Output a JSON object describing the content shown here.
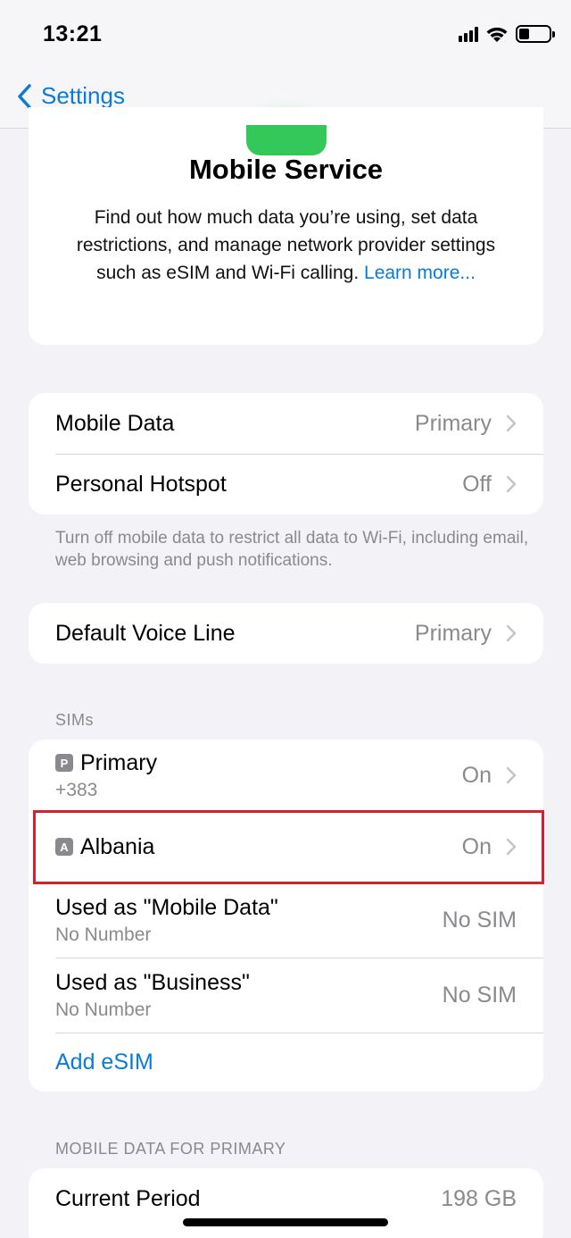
{
  "status_bar": {
    "time": "13:21",
    "signal_icon": "signal-bars-icon",
    "wifi_icon": "wifi-icon",
    "battery_icon": "battery-icon"
  },
  "nav": {
    "back_label": "Settings",
    "back_icon": "chevron-left-icon"
  },
  "hero": {
    "title": "Mobile Service",
    "description": "Find out how much data you’re using, set data restrictions, and manage network provider settings such as eSIM and Wi-Fi calling.",
    "link": "Learn more..."
  },
  "group1": {
    "rows": [
      {
        "label": "Mobile Data",
        "value": "Primary"
      },
      {
        "label": "Personal Hotspot",
        "value": "Off"
      }
    ],
    "footnote": "Turn off mobile data to restrict all data to Wi-Fi, including email, web browsing and push notifications."
  },
  "group2": {
    "rows": [
      {
        "label": "Default Voice Line",
        "value": "Primary"
      }
    ]
  },
  "sims": {
    "header": "SIMs",
    "items": [
      {
        "badge": "P",
        "label": "Primary",
        "sub": "+383",
        "value": "On"
      },
      {
        "badge": "A",
        "label": "Albania",
        "value": "On"
      },
      {
        "label": "Used as \"Mobile Data\"",
        "sub": "No Number",
        "value": "No SIM"
      },
      {
        "label": "Used as \"Business\"",
        "sub": "No Number",
        "value": "No SIM"
      }
    ],
    "add_label": "Add eSIM"
  },
  "data_section": {
    "header": "MOBILE DATA FOR PRIMARY",
    "rows": [
      {
        "label": "Current Period",
        "value": "198 GB"
      }
    ]
  },
  "colors": {
    "accent": "#0a7bd8",
    "highlight": "#d3222f",
    "green": "#34c759"
  }
}
